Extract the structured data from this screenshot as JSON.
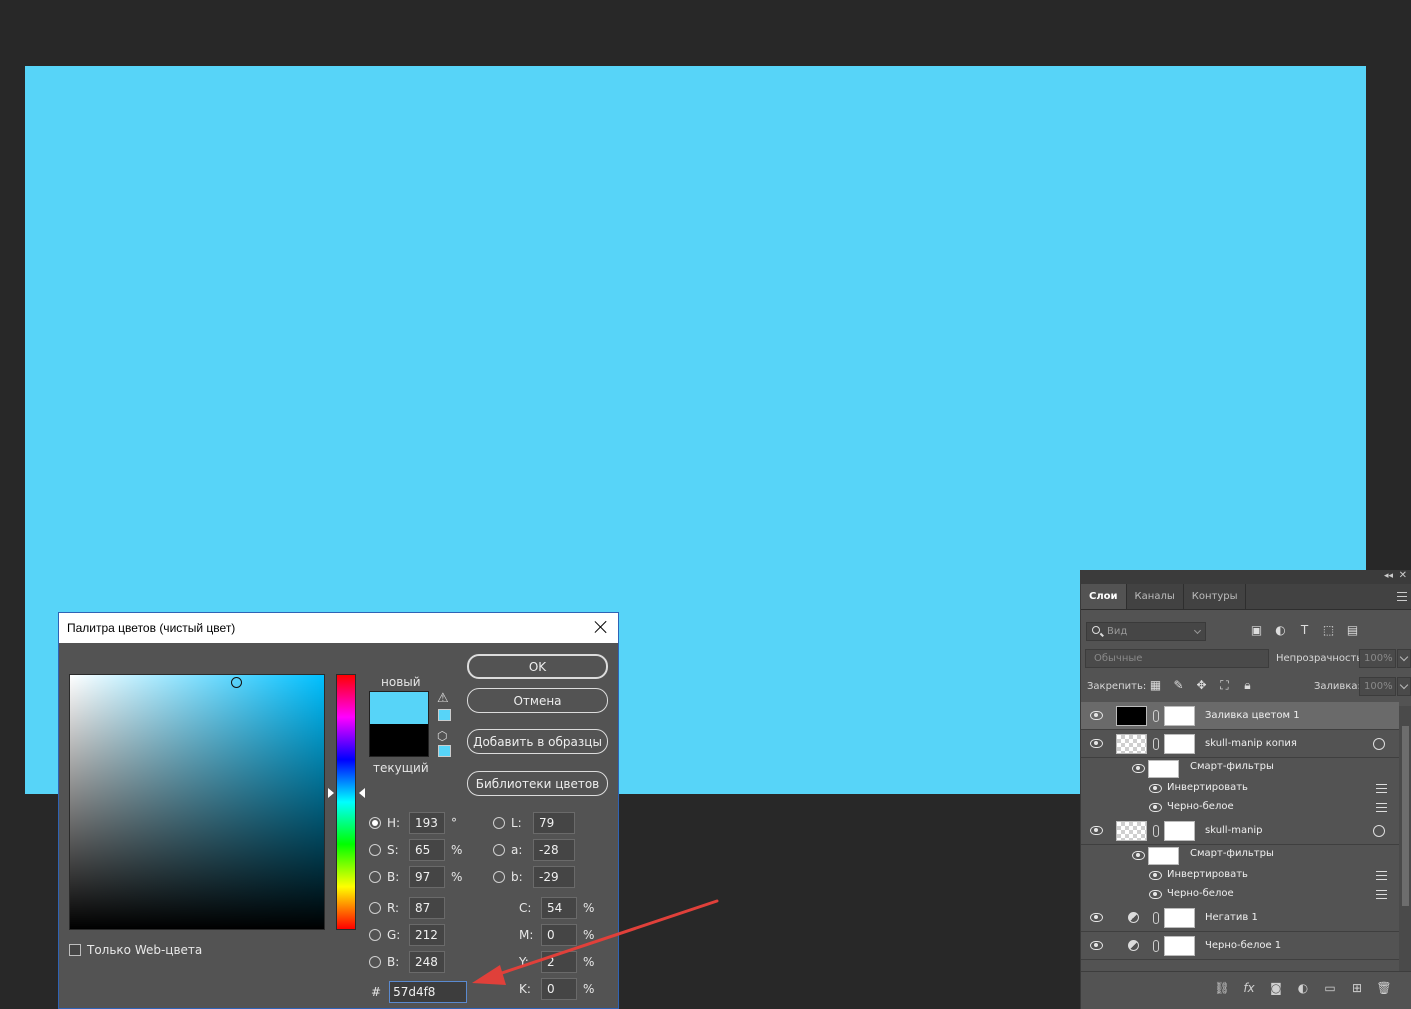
{
  "canvas": {
    "fill_color": "#57d4f8"
  },
  "picker": {
    "title": "Палитра цветов (чистый цвет)",
    "new_label": "новый",
    "current_label": "текущий",
    "new_color": "#57d4f8",
    "current_color": "#000000",
    "buttons": {
      "ok": "OK",
      "cancel": "Отмена",
      "add_to_swatches": "Добавить в образцы",
      "color_libraries": "Библиотеки цветов"
    },
    "hsb": {
      "h": {
        "label": "H:",
        "value": "193",
        "unit": "°",
        "selected": true
      },
      "s": {
        "label": "S:",
        "value": "65",
        "unit": "%"
      },
      "b": {
        "label": "B:",
        "value": "97",
        "unit": "%"
      }
    },
    "rgb": {
      "r": {
        "label": "R:",
        "value": "87"
      },
      "g": {
        "label": "G:",
        "value": "212"
      },
      "b": {
        "label": "B:",
        "value": "248"
      }
    },
    "lab": {
      "l": {
        "label": "L:",
        "value": "79"
      },
      "a": {
        "label": "a:",
        "value": "-28"
      },
      "b": {
        "label": "b:",
        "value": "-29"
      }
    },
    "cmyk": {
      "c": {
        "label": "C:",
        "value": "54",
        "unit": "%"
      },
      "m": {
        "label": "M:",
        "value": "0",
        "unit": "%"
      },
      "y": {
        "label": "Y:",
        "value": "2",
        "unit": "%"
      },
      "k": {
        "label": "K:",
        "value": "0",
        "unit": "%"
      }
    },
    "hex": {
      "label": "#",
      "value": "57d4f8"
    },
    "web_only": "Только Web-цвета"
  },
  "layers_panel": {
    "tabs": [
      "Слои",
      "Каналы",
      "Контуры"
    ],
    "search_placeholder": "Вид",
    "blend_mode": "Обычные",
    "opacity_label": "Непрозрачность:",
    "opacity_value": "100%",
    "lock_label": "Закрепить:",
    "fill_label": "Заливка:",
    "fill_value": "100%",
    "layers": [
      {
        "name": "Заливка цветом 1"
      },
      {
        "name": "skull-manip копия"
      },
      {
        "name": "Смарт-фильтры"
      },
      {
        "name": "Инвертировать"
      },
      {
        "name": "Черно-белое"
      },
      {
        "name": "skull-manip"
      },
      {
        "name": "Смарт-фильтры"
      },
      {
        "name": "Инвертировать"
      },
      {
        "name": "Черно-белое"
      },
      {
        "name": "Негатив 1"
      },
      {
        "name": "Черно-белое 1"
      }
    ],
    "bottom_icons": [
      "link-icon",
      "fx-icon",
      "mask-icon",
      "adjustment-icon",
      "folder-icon",
      "new-layer-icon",
      "trash-icon"
    ]
  }
}
